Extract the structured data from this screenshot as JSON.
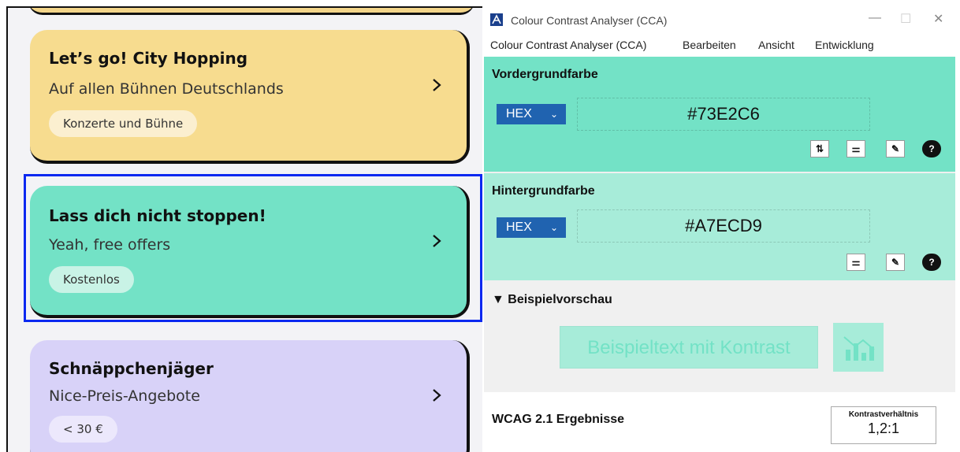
{
  "cards": [
    {
      "title": "Let’s go! City Hopping",
      "subtitle": "Auf allen Bühnen Deutschlands",
      "chip": "Konzerte und Bühne",
      "color": "#f7dc8f"
    },
    {
      "title": "Lass dich nicht stoppen!",
      "subtitle": "Yeah, free offers",
      "chip": "Kostenlos",
      "color": "#73e2c6"
    },
    {
      "title": "Schnäppchenjäger",
      "subtitle": "Nice-Preis-Angebote",
      "chip": "< 30 €",
      "color": "#d8d2f8"
    }
  ],
  "focus_color": "#0a28f0",
  "cca": {
    "title": "Colour Contrast Analyser (CCA)",
    "window_buttons": {
      "minimize": "—",
      "maximize": "☐",
      "close": "✕"
    },
    "menu": [
      "Colour Contrast Analyser (CCA)",
      "Bearbeiten",
      "Ansicht",
      "Entwicklung"
    ],
    "foreground": {
      "label": "Vordergrundfarbe",
      "format": "HEX",
      "value": "#73E2C6"
    },
    "background": {
      "label": "Hintergrundfarbe",
      "format": "HEX",
      "value": "#A7ECD9"
    },
    "preview": {
      "label": "▼ Beispielvorschau",
      "sample_text": "Beispieltext mit Kontrast"
    },
    "wcag": {
      "label": "WCAG 2.1 Ergebnisse",
      "ratio_label": "Kontrastverhältnis",
      "ratio_value": "1,2:1"
    },
    "tools": {
      "swap": "⇅",
      "sliders": "⚌",
      "picker": "✎",
      "help": "?"
    }
  }
}
